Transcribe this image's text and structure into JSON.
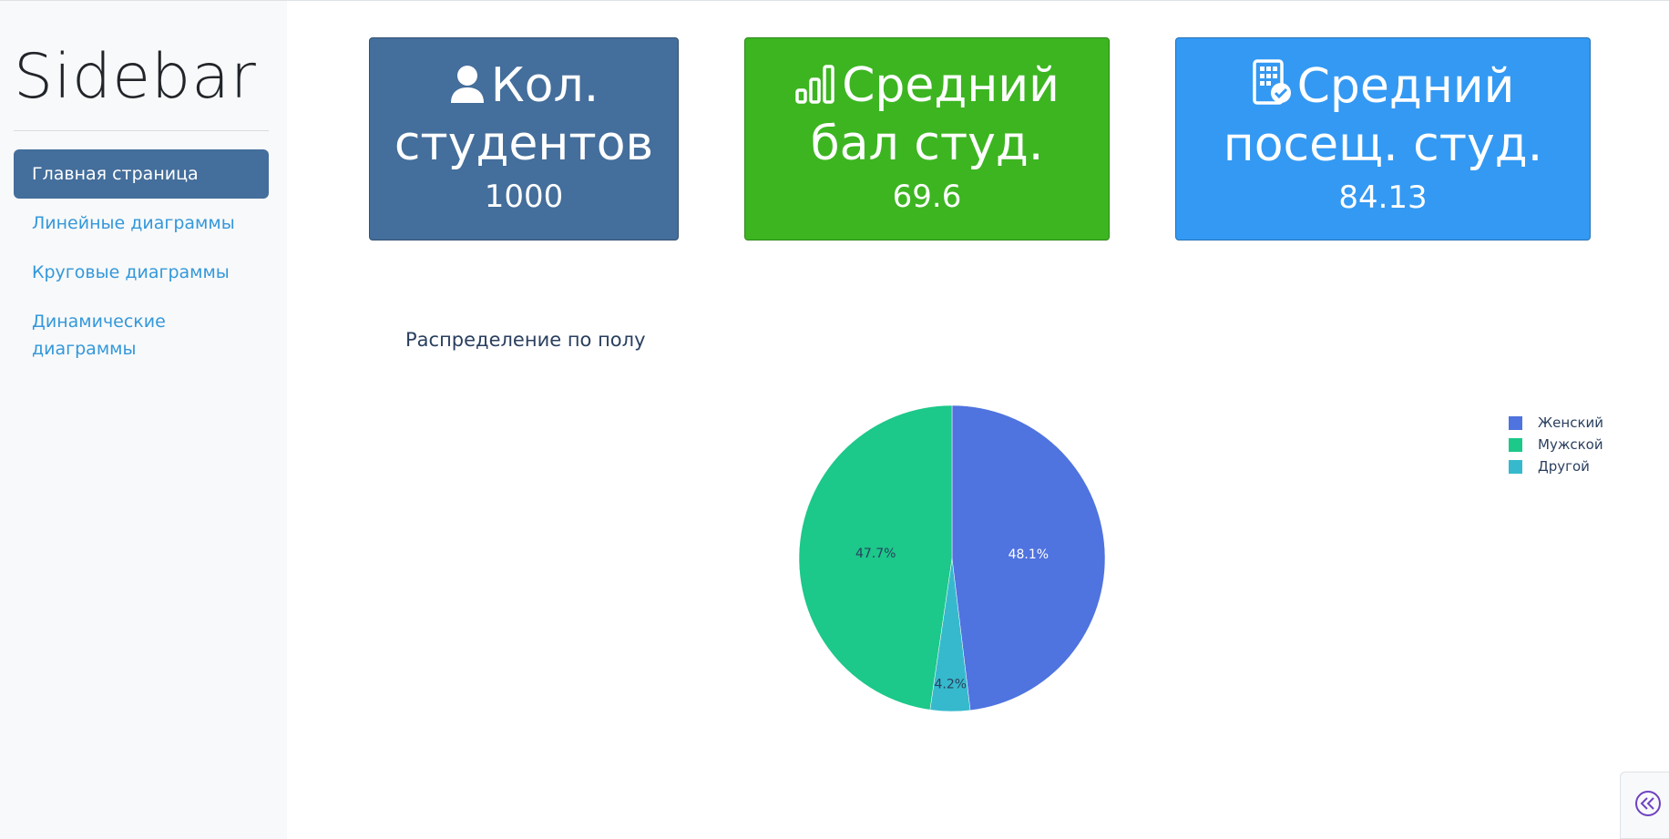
{
  "sidebar": {
    "title": "Sidebar",
    "items": [
      {
        "label": "Главная страница",
        "active": true
      },
      {
        "label": "Линейные диаграммы",
        "active": false
      },
      {
        "label": "Круговые диаграммы",
        "active": false
      },
      {
        "label": "Динамические диаграммы",
        "active": false
      }
    ]
  },
  "cards": [
    {
      "title": "Кол. студентов",
      "value": "1000",
      "icon": "user-icon",
      "color": "#446e9b"
    },
    {
      "title": "Средний бал студ.",
      "value": "69.6",
      "icon": "bar-chart-icon",
      "color": "#3cb521"
    },
    {
      "title": "Средний посещ. студ.",
      "value": "84.13",
      "icon": "building-check-icon",
      "color": "#3399f3"
    }
  ],
  "chart_data": {
    "type": "pie",
    "title": "Распределение по полу",
    "labels": [
      "Женский",
      "Мужской",
      "Другой"
    ],
    "values": [
      48.1,
      47.7,
      4.2
    ],
    "value_labels": [
      "48.1%",
      "47.7%",
      "4.2%"
    ],
    "colors": [
      "#4f73df",
      "#1cc88a",
      "#36b9cc"
    ],
    "legend": "top-right"
  },
  "controls": {
    "collapse_icon": "double-chevron-left-icon"
  }
}
